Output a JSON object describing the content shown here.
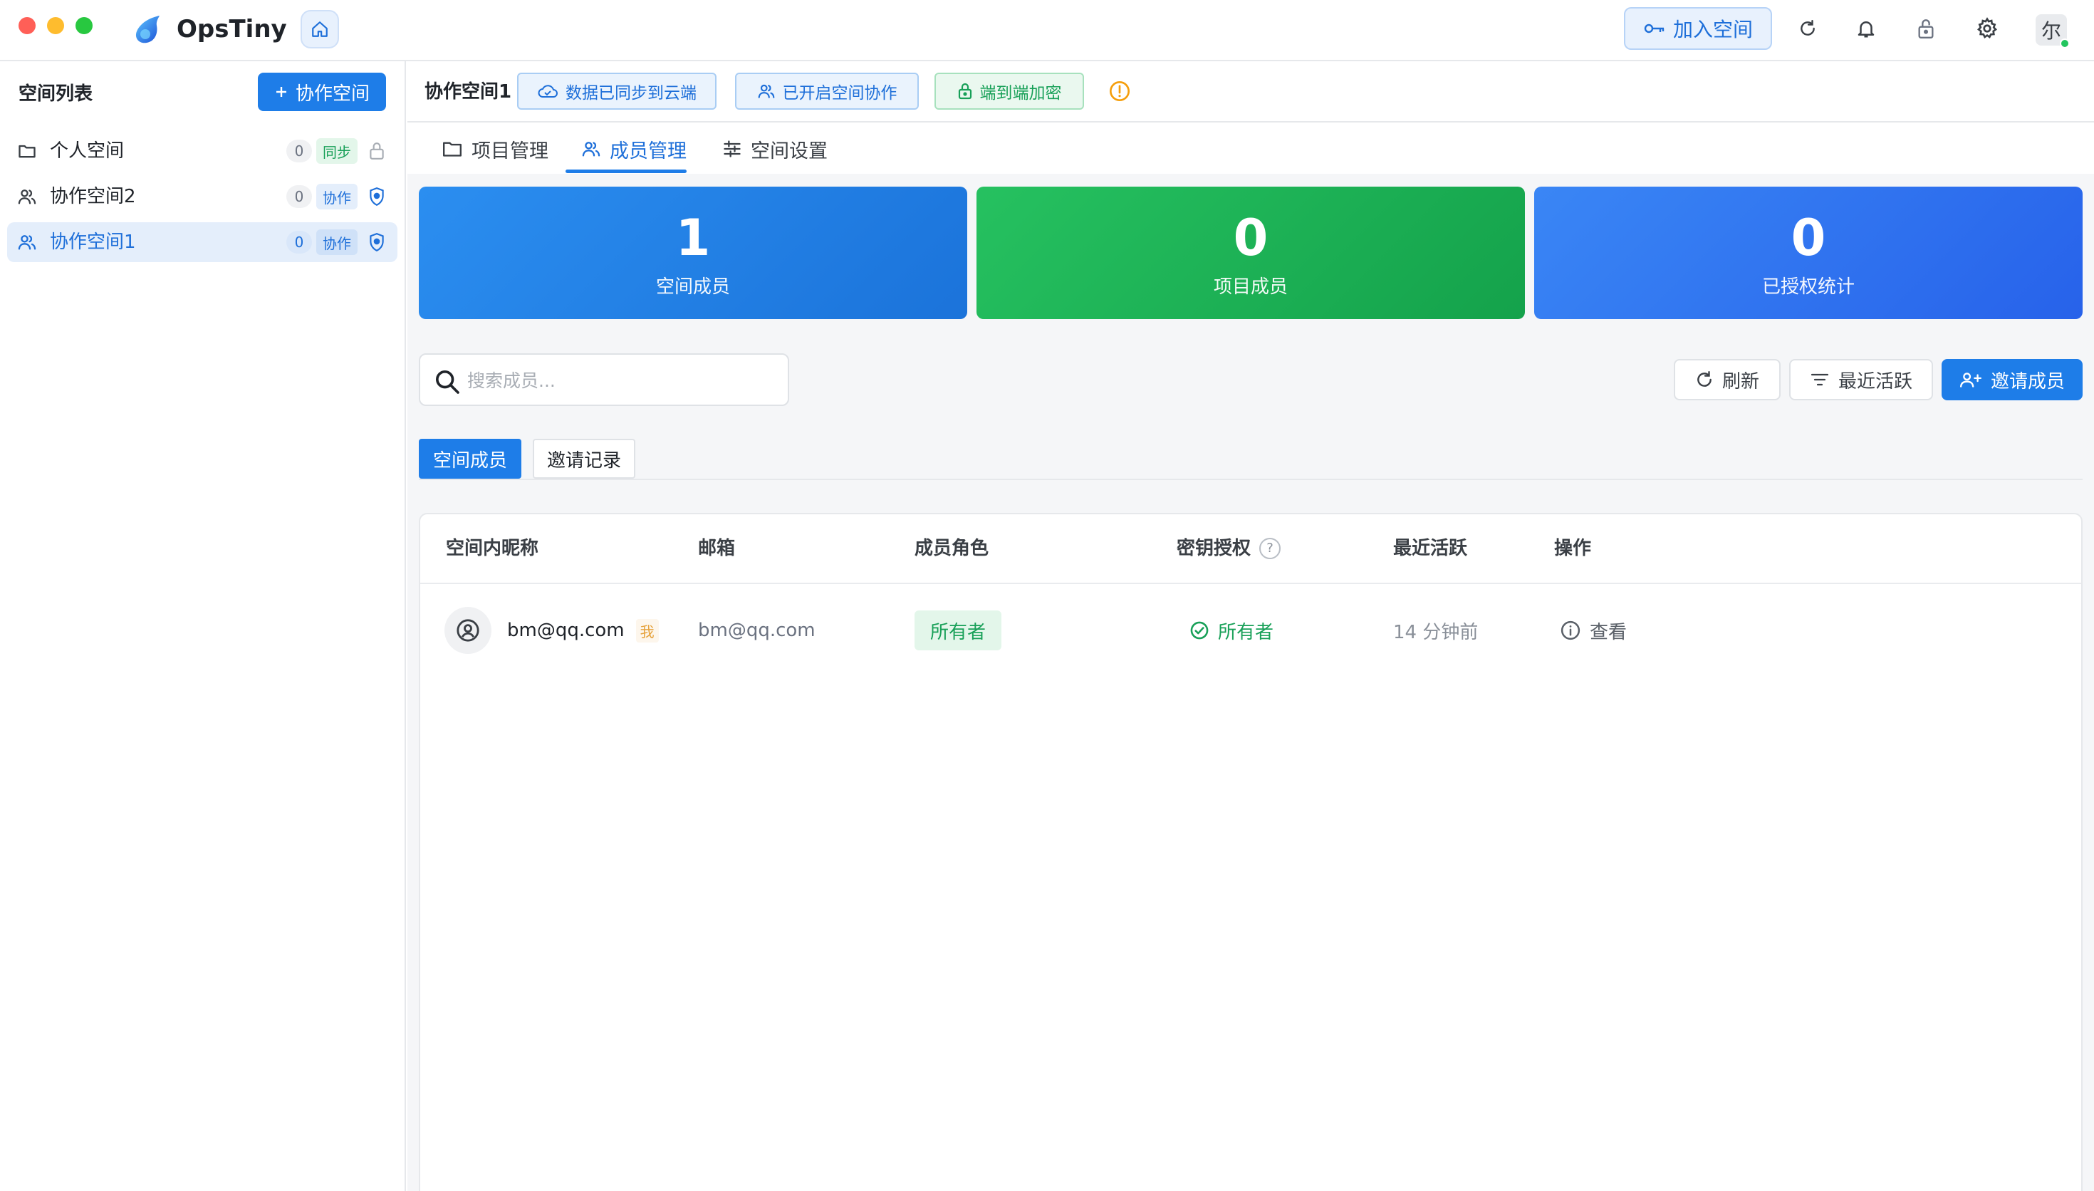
{
  "app": {
    "name": "OpsTiny",
    "join_label": "加入空间",
    "avatar_initial": "尔"
  },
  "sidebar": {
    "title": "空间列表",
    "add_label": "协作空间",
    "items": [
      {
        "label": "个人空间",
        "count": "0",
        "mode": "同步"
      },
      {
        "label": "协作空间2",
        "count": "0",
        "mode": "协作"
      },
      {
        "label": "协作空间1",
        "count": "0",
        "mode": "协作"
      }
    ]
  },
  "header": {
    "title": "协作空间1",
    "badges": {
      "sync": "数据已同步到云端",
      "collab": "已开启空间协作",
      "e2e": "端到端加密"
    }
  },
  "tabs": [
    {
      "label": "项目管理"
    },
    {
      "label": "成员管理"
    },
    {
      "label": "空间设置"
    }
  ],
  "stats": [
    {
      "value": "1",
      "label": "空间成员"
    },
    {
      "value": "0",
      "label": "项目成员"
    },
    {
      "value": "0",
      "label": "已授权统计"
    }
  ],
  "search": {
    "placeholder": "搜索成员..."
  },
  "actions": {
    "refresh": "刷新",
    "recent": "最近活跃",
    "invite": "邀请成员"
  },
  "subtabs": {
    "members": "空间成员",
    "invites": "邀请记录"
  },
  "table": {
    "headers": {
      "nickname": "空间内昵称",
      "email": "邮箱",
      "role": "成员角色",
      "key": "密钥授权",
      "help": "?",
      "active": "最近活跃",
      "ops": "操作"
    },
    "rows": [
      {
        "nickname": "bm@qq.com",
        "me": "我",
        "email": "bm@qq.com",
        "role": "所有者",
        "key": "所有者",
        "active": "14 分钟前",
        "op": "查看"
      }
    ]
  },
  "colors": {
    "accent": "#1e7de8",
    "success": "#18a058",
    "warning": "#f59e0b"
  }
}
